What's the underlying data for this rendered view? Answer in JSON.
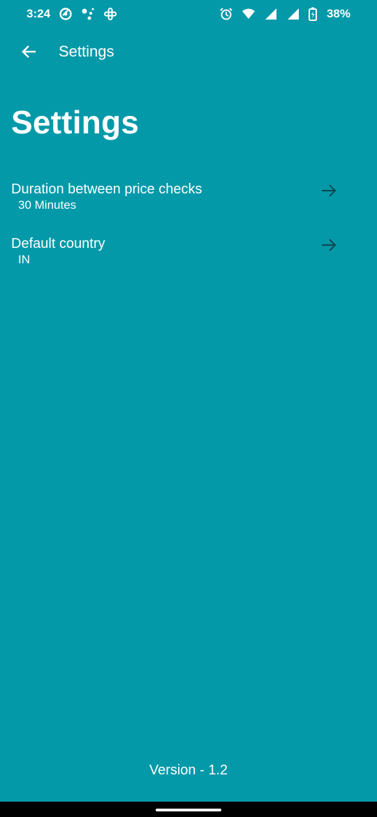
{
  "status_bar": {
    "time": "3:24",
    "battery": "38%",
    "left_icons": [
      "do-not-disturb-icon",
      "assistant-icon",
      "slack-icon"
    ],
    "right_icons": [
      "alarm-icon",
      "wifi-icon",
      "signal-icon",
      "signal-icon",
      "battery-icon"
    ]
  },
  "app_bar": {
    "title": "Settings"
  },
  "page": {
    "title": "Settings"
  },
  "settings": {
    "items": [
      {
        "title": "Duration between price checks",
        "value": "30 Minutes",
        "icon": "arrow-right-icon"
      },
      {
        "title": "Default country",
        "value": "IN",
        "icon": "arrow-right-icon"
      }
    ]
  },
  "footer": {
    "version": "Version - 1.2"
  },
  "colors": {
    "background": "#0499a9",
    "text": "#ffffff",
    "arrow": "#0b4b52",
    "nav_bar": "#000000"
  }
}
